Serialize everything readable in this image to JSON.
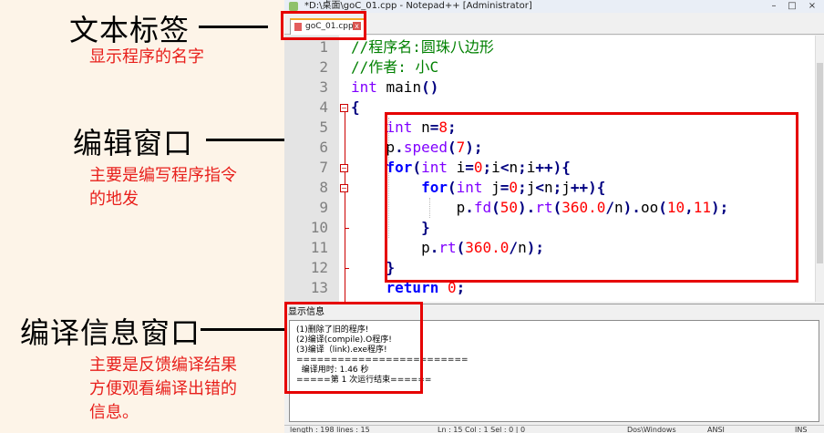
{
  "annotations": {
    "tab_title": "文本标签",
    "tab_desc": "显示程序的名字",
    "editor_title": "编辑窗口",
    "editor_desc_1": "主要是编写程序指令",
    "editor_desc_2": "的地发",
    "output_title": "编译信息窗口",
    "output_desc_1": "主要是反馈编译结果",
    "output_desc_2": "方便观看编译出错的",
    "output_desc_3": "信息。"
  },
  "window": {
    "title": "*D:\\桌面\\goC_01.cpp - Notepad++ [Administrator]",
    "minimize": "–",
    "maximize": "□",
    "close": "×"
  },
  "tab": {
    "label": "goC_01.cpp",
    "close": "x"
  },
  "editor": {
    "line_numbers": [
      "1",
      "2",
      "3",
      "4",
      "5",
      "6",
      "7",
      "8",
      "9",
      "10",
      "11",
      "12",
      "13"
    ],
    "lines": [
      [
        {
          "t": "//程序名:圆珠八边形",
          "c": "c-comment"
        }
      ],
      [
        {
          "t": "//作者: 小C",
          "c": "c-comment"
        }
      ],
      [
        {
          "t": "int",
          "c": "c-type"
        },
        {
          "t": " main",
          "c": "c-ident"
        },
        {
          "t": "()",
          "c": "c-op"
        }
      ],
      [
        {
          "t": "{",
          "c": "c-op"
        }
      ],
      [
        {
          "t": "    ",
          "c": "c-ident"
        },
        {
          "t": "int",
          "c": "c-type"
        },
        {
          "t": " n",
          "c": "c-ident"
        },
        {
          "t": "=",
          "c": "c-op"
        },
        {
          "t": "8",
          "c": "c-num"
        },
        {
          "t": ";",
          "c": "c-op"
        }
      ],
      [
        {
          "t": "    ",
          "c": "c-ident"
        },
        {
          "t": "p",
          "c": "c-ident"
        },
        {
          "t": ".",
          "c": "c-op"
        },
        {
          "t": "speed",
          "c": "c-type"
        },
        {
          "t": "(",
          "c": "c-op"
        },
        {
          "t": "7",
          "c": "c-num"
        },
        {
          "t": ");",
          "c": "c-op"
        }
      ],
      [
        {
          "t": "    ",
          "c": "c-ident"
        },
        {
          "t": "for",
          "c": "c-kw"
        },
        {
          "t": "(",
          "c": "c-op"
        },
        {
          "t": "int",
          "c": "c-type"
        },
        {
          "t": " i",
          "c": "c-ident"
        },
        {
          "t": "=",
          "c": "c-op"
        },
        {
          "t": "0",
          "c": "c-num"
        },
        {
          "t": ";",
          "c": "c-op"
        },
        {
          "t": "i",
          "c": "c-ident"
        },
        {
          "t": "<",
          "c": "c-op"
        },
        {
          "t": "n",
          "c": "c-ident"
        },
        {
          "t": ";",
          "c": "c-op"
        },
        {
          "t": "i",
          "c": "c-ident"
        },
        {
          "t": "++){",
          "c": "c-op"
        }
      ],
      [
        {
          "t": "        ",
          "c": "c-ident"
        },
        {
          "t": "for",
          "c": "c-kw"
        },
        {
          "t": "(",
          "c": "c-op"
        },
        {
          "t": "int",
          "c": "c-type"
        },
        {
          "t": " j",
          "c": "c-ident"
        },
        {
          "t": "=",
          "c": "c-op"
        },
        {
          "t": "0",
          "c": "c-num"
        },
        {
          "t": ";",
          "c": "c-op"
        },
        {
          "t": "j",
          "c": "c-ident"
        },
        {
          "t": "<",
          "c": "c-op"
        },
        {
          "t": "n",
          "c": "c-ident"
        },
        {
          "t": ";",
          "c": "c-op"
        },
        {
          "t": "j",
          "c": "c-ident"
        },
        {
          "t": "++){",
          "c": "c-op"
        }
      ],
      [
        {
          "t": "            ",
          "c": "c-ident"
        },
        {
          "t": "p",
          "c": "c-ident"
        },
        {
          "t": ".",
          "c": "c-op"
        },
        {
          "t": "fd",
          "c": "c-type"
        },
        {
          "t": "(",
          "c": "c-op"
        },
        {
          "t": "50",
          "c": "c-num"
        },
        {
          "t": ").",
          "c": "c-op"
        },
        {
          "t": "rt",
          "c": "c-type"
        },
        {
          "t": "(",
          "c": "c-op"
        },
        {
          "t": "360.0",
          "c": "c-num"
        },
        {
          "t": "/",
          "c": "c-op"
        },
        {
          "t": "n",
          "c": "c-ident"
        },
        {
          "t": ").",
          "c": "c-op"
        },
        {
          "t": "oo",
          "c": "c-ident"
        },
        {
          "t": "(",
          "c": "c-op"
        },
        {
          "t": "10",
          "c": "c-num"
        },
        {
          "t": ",",
          "c": "c-op"
        },
        {
          "t": "11",
          "c": "c-num"
        },
        {
          "t": ");",
          "c": "c-op"
        }
      ],
      [
        {
          "t": "        ",
          "c": "c-ident"
        },
        {
          "t": "}",
          "c": "c-op"
        }
      ],
      [
        {
          "t": "        ",
          "c": "c-ident"
        },
        {
          "t": "p",
          "c": "c-ident"
        },
        {
          "t": ".",
          "c": "c-op"
        },
        {
          "t": "rt",
          "c": "c-type"
        },
        {
          "t": "(",
          "c": "c-op"
        },
        {
          "t": "360.0",
          "c": "c-num"
        },
        {
          "t": "/",
          "c": "c-op"
        },
        {
          "t": "n",
          "c": "c-ident"
        },
        {
          "t": ");",
          "c": "c-op"
        }
      ],
      [
        {
          "t": "    ",
          "c": "c-ident"
        },
        {
          "t": "}",
          "c": "c-op"
        }
      ],
      [
        {
          "t": "    ",
          "c": "c-ident"
        },
        {
          "t": "return",
          "c": "c-kw"
        },
        {
          "t": " ",
          "c": "c-ident"
        },
        {
          "t": "0",
          "c": "c-num"
        },
        {
          "t": ";",
          "c": "c-op"
        }
      ]
    ]
  },
  "output": {
    "title": "显示信息",
    "lines": [
      "(1)删除了旧的程序!",
      "(2)编译(compile).O程序!",
      "(3)编译（link).exe程序!",
      "=========================",
      "  编译用时: 1.46 秒",
      "=====第 1 次运行结束======"
    ]
  },
  "status": {
    "length": "length : 198    lines : 15",
    "position": "Ln : 15    Col : 1    Sel : 0 | 0",
    "eol": "Dos\\Windows",
    "encoding": "ANSI",
    "mode": "INS"
  }
}
